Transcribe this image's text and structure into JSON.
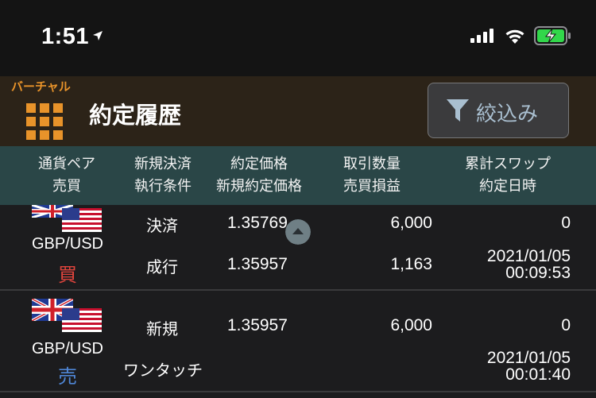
{
  "status_bar": {
    "time": "1:51"
  },
  "header": {
    "mode_label": "バーチャル",
    "title": "約定履歴",
    "filter_label": "絞込み"
  },
  "columns": [
    {
      "line1": "通貨ペア",
      "line2": "売買"
    },
    {
      "line1": "新規決済",
      "line2": "執行条件"
    },
    {
      "line1": "約定価格",
      "line2": "新規約定価格"
    },
    {
      "line1": "取引数量",
      "line2": "売買損益"
    },
    {
      "line1": "累計スワップ",
      "line2": "約定日時"
    }
  ],
  "rows": [
    {
      "pair": "GBP/USD",
      "side": "買",
      "side_color": "#e0443c",
      "type": "決済",
      "condition": "成行",
      "price": "1.35769",
      "new_price": "1.35957",
      "quantity": "6,000",
      "pnl": "1,163",
      "swap": "0",
      "date": "2021/01/05",
      "time": "00:09:53"
    },
    {
      "pair": "GBP/USD",
      "side": "売",
      "side_color": "#4f86d6",
      "type": "新規",
      "condition": "ワンタッチ",
      "price": "1.35957",
      "new_price": "",
      "quantity": "6,000",
      "pnl": "",
      "swap": "0",
      "date": "2021/01/05",
      "time": "00:01:40"
    }
  ]
}
